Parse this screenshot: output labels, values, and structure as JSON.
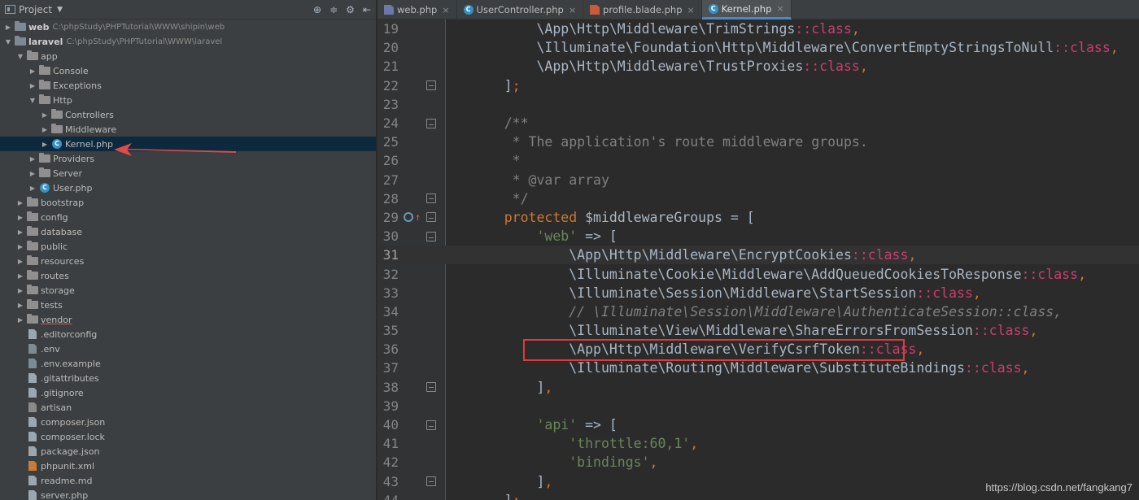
{
  "project_panel": {
    "title": "Project",
    "tree": [
      {
        "label": "web",
        "path": "C:\\phpStudy\\PHPTutorial\\WWW\\shipin\\web",
        "kind": "module",
        "depth": 0,
        "arrow": "▶",
        "bold": true
      },
      {
        "label": "laravel",
        "path": "C:\\phpStudy\\PHPTutorial\\WWW\\laravel",
        "kind": "module",
        "depth": 0,
        "arrow": "▼",
        "bold": true
      },
      {
        "label": "app",
        "kind": "folder",
        "depth": 1,
        "arrow": "▼"
      },
      {
        "label": "Console",
        "kind": "folder",
        "depth": 2,
        "arrow": "▶"
      },
      {
        "label": "Exceptions",
        "kind": "folder",
        "depth": 2,
        "arrow": "▶"
      },
      {
        "label": "Http",
        "kind": "folder",
        "depth": 2,
        "arrow": "▼"
      },
      {
        "label": "Controllers",
        "kind": "folder",
        "depth": 3,
        "arrow": "▶"
      },
      {
        "label": "Middleware",
        "kind": "folder",
        "depth": 3,
        "arrow": "▶"
      },
      {
        "label": "Kernel.php",
        "kind": "class",
        "depth": 3,
        "arrow": "▶",
        "selected": true
      },
      {
        "label": "Providers",
        "kind": "folder",
        "depth": 2,
        "arrow": "▶"
      },
      {
        "label": "Server",
        "kind": "folder",
        "depth": 2,
        "arrow": "▶"
      },
      {
        "label": "User.php",
        "kind": "class",
        "depth": 2,
        "arrow": "▶"
      },
      {
        "label": "bootstrap",
        "kind": "folder",
        "depth": 1,
        "arrow": "▶"
      },
      {
        "label": "config",
        "kind": "folder",
        "depth": 1,
        "arrow": "▶"
      },
      {
        "label": "database",
        "kind": "folder",
        "depth": 1,
        "arrow": "▶"
      },
      {
        "label": "public",
        "kind": "folder",
        "depth": 1,
        "arrow": "▶"
      },
      {
        "label": "resources",
        "kind": "folder",
        "depth": 1,
        "arrow": "▶"
      },
      {
        "label": "routes",
        "kind": "folder",
        "depth": 1,
        "arrow": "▶"
      },
      {
        "label": "storage",
        "kind": "folder",
        "depth": 1,
        "arrow": "▶"
      },
      {
        "label": "tests",
        "kind": "folder",
        "depth": 1,
        "arrow": "▶"
      },
      {
        "label": "vendor",
        "kind": "folder",
        "depth": 1,
        "arrow": "▶",
        "underline": true
      },
      {
        "label": ".editorconfig",
        "kind": "file",
        "depth": 1
      },
      {
        "label": ".env",
        "kind": "env",
        "depth": 1
      },
      {
        "label": ".env.example",
        "kind": "env",
        "depth": 1
      },
      {
        "label": ".gitattributes",
        "kind": "file",
        "depth": 1
      },
      {
        "label": ".gitignore",
        "kind": "file",
        "depth": 1
      },
      {
        "label": "artisan",
        "kind": "art",
        "depth": 1
      },
      {
        "label": "composer.json",
        "kind": "file",
        "depth": 1
      },
      {
        "label": "composer.lock",
        "kind": "file",
        "depth": 1
      },
      {
        "label": "package.json",
        "kind": "file",
        "depth": 1
      },
      {
        "label": "phpunit.xml",
        "kind": "xml",
        "depth": 1
      },
      {
        "label": "readme.md",
        "kind": "file",
        "depth": 1
      },
      {
        "label": "server.php",
        "kind": "file",
        "depth": 1
      }
    ]
  },
  "tabs": [
    {
      "label": "web.php",
      "icon": "php",
      "active": false
    },
    {
      "label": "UserController.php",
      "icon": "cls",
      "active": false
    },
    {
      "label": "profile.blade.php",
      "icon": "blade",
      "active": false
    },
    {
      "label": "Kernel.php",
      "icon": "cls",
      "active": true
    }
  ],
  "code_lines": [
    {
      "n": "19",
      "tokens": [
        [
          "plain",
          "        \\App\\Http\\Middleware\\TrimStrings"
        ],
        [
          "cls",
          "::class"
        ],
        [
          "punc",
          ","
        ]
      ]
    },
    {
      "n": "20",
      "tokens": [
        [
          "plain",
          "        \\Illuminate\\Foundation\\Http\\Middleware\\ConvertEmptyStringsToNull"
        ],
        [
          "cls",
          "::class"
        ],
        [
          "punc",
          ","
        ]
      ]
    },
    {
      "n": "21",
      "tokens": [
        [
          "plain",
          "        \\App\\Http\\Middleware\\TrustProxies"
        ],
        [
          "cls",
          "::class"
        ],
        [
          "punc",
          ","
        ]
      ]
    },
    {
      "n": "22",
      "marker": "up",
      "tokens": [
        [
          "plain",
          "    ]"
        ],
        [
          "punc",
          ";"
        ]
      ]
    },
    {
      "n": "23",
      "tokens": []
    },
    {
      "n": "24",
      "marker": "down",
      "tokens": [
        [
          "com",
          "    /**"
        ]
      ]
    },
    {
      "n": "25",
      "tokens": [
        [
          "com",
          "     * The application's route middleware groups."
        ]
      ]
    },
    {
      "n": "26",
      "tokens": [
        [
          "com",
          "     *"
        ]
      ]
    },
    {
      "n": "27",
      "tokens": [
        [
          "com",
          "     * @var array"
        ]
      ]
    },
    {
      "n": "28",
      "marker": "up",
      "tokens": [
        [
          "com",
          "     */"
        ]
      ]
    },
    {
      "n": "29",
      "marker": "down",
      "override": true,
      "tokens": [
        [
          "kw",
          "    protected "
        ],
        [
          "var",
          "$middlewareGroups "
        ],
        [
          "plain",
          "= ["
        ]
      ]
    },
    {
      "n": "30",
      "marker": "down",
      "tokens": [
        [
          "str",
          "        'web' "
        ],
        [
          "plain",
          "=> ["
        ]
      ]
    },
    {
      "n": "31",
      "current": true,
      "tokens": [
        [
          "plain",
          "            \\App\\Http\\Middleware\\EncryptCookies"
        ],
        [
          "cls",
          "::class"
        ],
        [
          "punc",
          ","
        ]
      ]
    },
    {
      "n": "32",
      "tokens": [
        [
          "plain",
          "            \\Illuminate\\Cookie\\Middleware\\AddQueuedCookiesToResponse"
        ],
        [
          "cls",
          "::class"
        ],
        [
          "punc",
          ","
        ]
      ]
    },
    {
      "n": "33",
      "tokens": [
        [
          "plain",
          "            \\Illuminate\\Session\\Middleware\\StartSession"
        ],
        [
          "cls",
          "::class"
        ],
        [
          "punc",
          ","
        ]
      ]
    },
    {
      "n": "34",
      "tokens": [
        [
          "comi",
          "            // \\Illuminate\\Session\\Middleware\\AuthenticateSession::class,"
        ]
      ]
    },
    {
      "n": "35",
      "tokens": [
        [
          "plain",
          "            \\Illuminate\\View\\Middleware\\ShareErrorsFromSession"
        ],
        [
          "cls",
          "::class"
        ],
        [
          "punc",
          ","
        ]
      ]
    },
    {
      "n": "36",
      "tokens": [
        [
          "plain",
          "            \\App\\Http\\Middleware\\VerifyCsrfToken"
        ],
        [
          "cls",
          "::class"
        ],
        [
          "punc",
          ","
        ]
      ]
    },
    {
      "n": "37",
      "tokens": [
        [
          "plain",
          "            \\Illuminate\\Routing\\Middleware\\SubstituteBindings"
        ],
        [
          "cls",
          "::class"
        ],
        [
          "punc",
          ","
        ]
      ]
    },
    {
      "n": "38",
      "marker": "up",
      "tokens": [
        [
          "plain",
          "        ]"
        ],
        [
          "punc",
          ","
        ]
      ]
    },
    {
      "n": "39",
      "tokens": []
    },
    {
      "n": "40",
      "marker": "down",
      "tokens": [
        [
          "str",
          "        'api' "
        ],
        [
          "plain",
          "=> ["
        ]
      ]
    },
    {
      "n": "41",
      "tokens": [
        [
          "str",
          "            'throttle:60,1'"
        ],
        [
          "punc",
          ","
        ]
      ]
    },
    {
      "n": "42",
      "tokens": [
        [
          "str",
          "            'bindings'"
        ],
        [
          "punc",
          ","
        ]
      ]
    },
    {
      "n": "43",
      "marker": "up",
      "tokens": [
        [
          "plain",
          "        ]"
        ],
        [
          "punc",
          ","
        ]
      ]
    },
    {
      "n": "44",
      "tokens": [
        [
          "plain",
          "    ]"
        ],
        [
          "punc",
          ";"
        ]
      ]
    }
  ],
  "watermark": "https://blog.csdn.net/fangkang7"
}
